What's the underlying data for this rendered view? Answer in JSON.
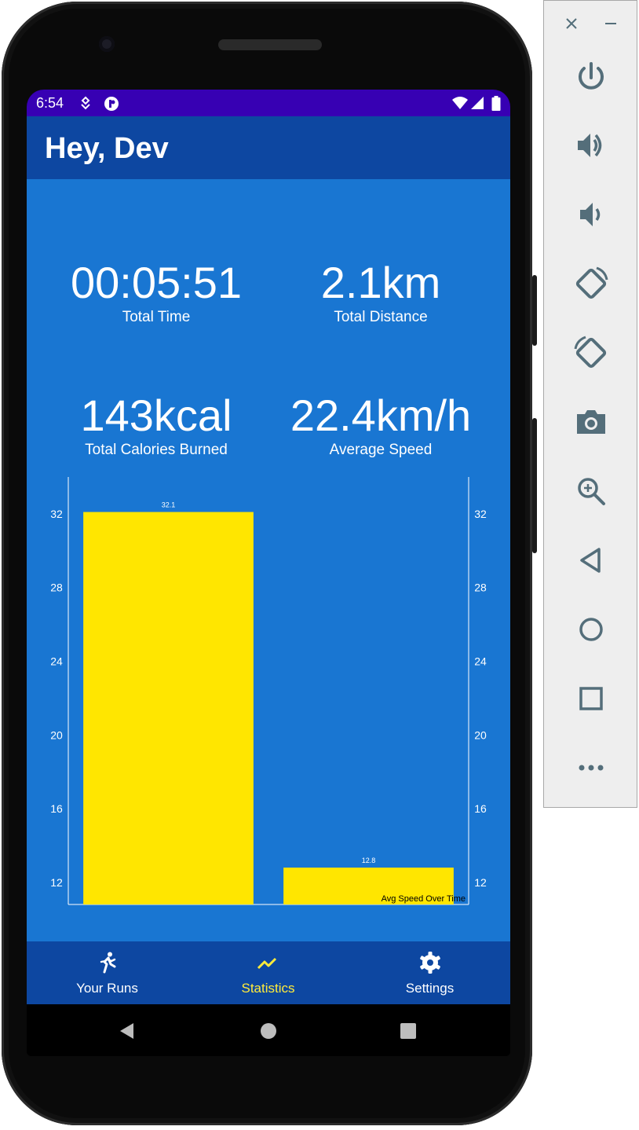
{
  "status_bar": {
    "time": "6:54"
  },
  "app_bar": {
    "title": "Hey, Dev"
  },
  "stats": {
    "total_time": {
      "value": "00:05:51",
      "label": "Total Time"
    },
    "total_distance": {
      "value": "2.1km",
      "label": "Total Distance"
    },
    "total_calories": {
      "value": "143kcal",
      "label": "Total Calories Burned"
    },
    "average_speed": {
      "value": "22.4km/h",
      "label": "Average Speed"
    }
  },
  "chart_data": {
    "type": "bar",
    "description": "Avg Speed Over Time",
    "values": [
      32.1,
      12.8
    ],
    "value_labels": [
      "32.1",
      "12.8"
    ],
    "y_ticks": [
      "12",
      "16",
      "20",
      "24",
      "28",
      "32"
    ],
    "y_tick_values": [
      12,
      16,
      20,
      24,
      28,
      32
    ],
    "ylim": [
      10.8,
      34
    ],
    "bar_color": "#ffe600",
    "axis_color": "#ffffff",
    "grid": false,
    "dual_y_axis": true
  },
  "bottom_nav": {
    "items": [
      {
        "label": "Your Runs",
        "icon": "run-icon",
        "active": false
      },
      {
        "label": "Statistics",
        "icon": "trending-up-icon",
        "active": true
      },
      {
        "label": "Settings",
        "icon": "gear-icon",
        "active": false
      }
    ]
  },
  "emulator_toolbar": {
    "buttons": [
      "power-icon",
      "volume-up-icon",
      "volume-down-icon",
      "rotate-left-icon",
      "rotate-right-icon",
      "camera-icon",
      "zoom-icon",
      "back-icon",
      "home-icon",
      "overview-icon",
      "more-icon"
    ]
  },
  "colors": {
    "status_bar": "#3700b3",
    "primary_dark": "#0d47a1",
    "primary": "#1976d2",
    "accent": "#ffeb3b"
  }
}
